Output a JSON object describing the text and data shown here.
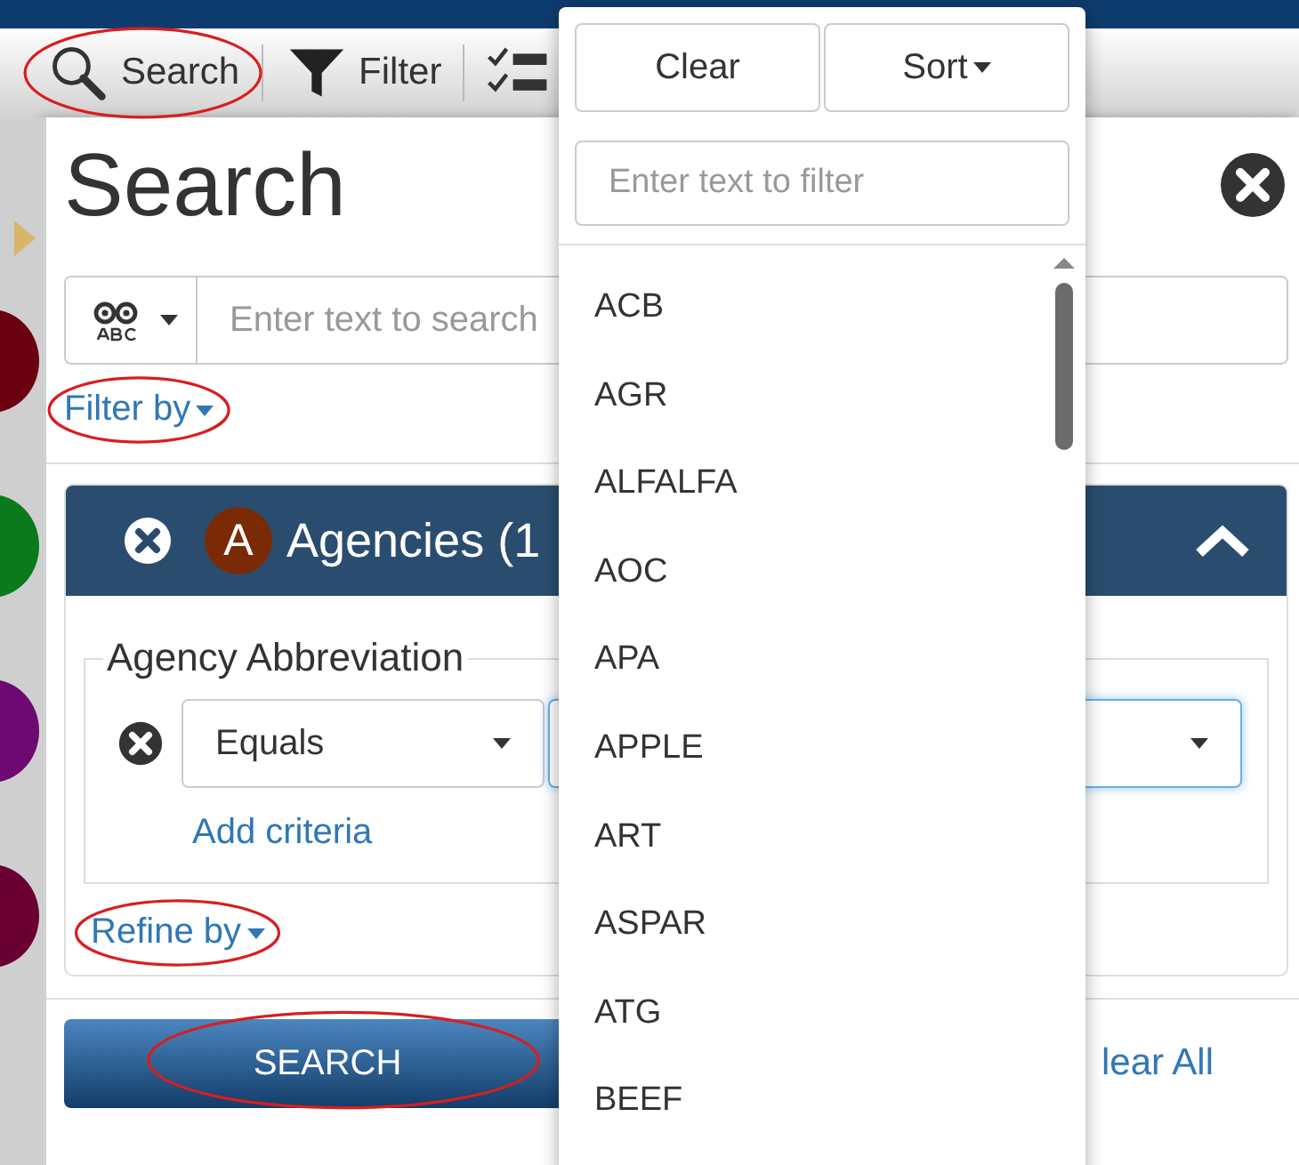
{
  "toolbar": {
    "items": [
      {
        "kind": "search",
        "label": "Search",
        "circled": true
      },
      {
        "kind": "filter",
        "label": "Filter"
      },
      {
        "kind": "checklist"
      }
    ]
  },
  "side_avatars": [
    {
      "color": "#6a0010"
    },
    {
      "color": "#0b7a1c"
    },
    {
      "color": "#6c0a72"
    },
    {
      "color": "#6a0032"
    }
  ],
  "search_panel": {
    "title": "Search",
    "search_field": {
      "placeholder": "Enter text to search"
    },
    "filter_by": {
      "label": "Filter by",
      "circled": true
    },
    "criteria_card": {
      "avatar_letter": "A",
      "title": "Agencies (1",
      "expanded": true,
      "group": {
        "legend": "Agency Abbreviation",
        "operator": "Equals",
        "add_link": "Add criteria"
      }
    },
    "refine_by": {
      "label": "Refine by",
      "circled": true
    },
    "search_button": {
      "label": "SEARCH",
      "circled": true
    },
    "clear_all_link": "lear All"
  },
  "dropdown": {
    "buttons": [
      {
        "kind": "plain",
        "label": "Clear"
      },
      {
        "kind": "menu",
        "label": "Sort"
      }
    ],
    "filter_field": {
      "placeholder": "Enter text to filter"
    },
    "options": [
      "ACB",
      "AGR",
      "ALFALFA",
      "AOC",
      "APA",
      "APPLE",
      "ART",
      "ASPAR",
      "ATG",
      "BEEF"
    ]
  }
}
